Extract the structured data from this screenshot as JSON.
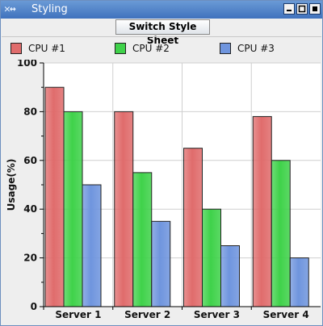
{
  "window": {
    "title": "Styling",
    "app_icon": "x-logo-icon",
    "controls": [
      "minimize-icon",
      "maximize-icon",
      "close-icon"
    ]
  },
  "toolbar": {
    "switch_label": "Switch Style Sheet"
  },
  "colors": {
    "cpu1": "#e06c6c",
    "cpu2": "#3fd24a",
    "cpu3": "#6f95de",
    "titlebar": "#4a7fc8"
  },
  "chart_data": {
    "type": "bar",
    "categories": [
      "Server 1",
      "Server 2",
      "Server 3",
      "Server 4"
    ],
    "series": [
      {
        "name": "CPU #1",
        "values": [
          90,
          80,
          65,
          78
        ]
      },
      {
        "name": "CPU #2",
        "values": [
          80,
          55,
          40,
          60
        ]
      },
      {
        "name": "CPU #3",
        "values": [
          50,
          35,
          25,
          20
        ]
      }
    ],
    "ylabel": "Usage(%)",
    "ylim": [
      0,
      100
    ],
    "yticks": [
      0,
      20,
      40,
      60,
      80,
      100
    ],
    "grid": true,
    "legend": "top"
  }
}
